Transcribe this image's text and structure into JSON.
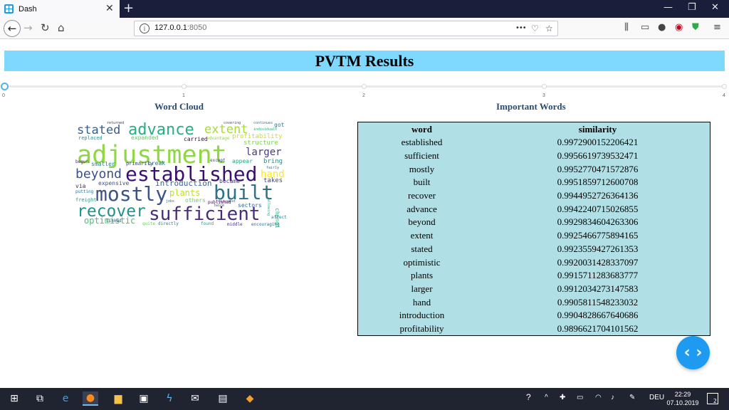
{
  "browser": {
    "tab_title": "Dash",
    "close_glyph": "✕",
    "newtab_glyph": "+",
    "url_host": "127.0.0.1",
    "url_port": ":8050",
    "more_glyph": "•••",
    "win_minimize": "—",
    "win_restore": "❐",
    "win_close": "✕"
  },
  "page": {
    "title": "PVTM Results",
    "word_cloud_title": "Word Cloud",
    "important_words_title": "Important Words"
  },
  "slider": {
    "marks": [
      "0",
      "1",
      "2",
      "3",
      "4"
    ],
    "value": 0
  },
  "word_cloud": {
    "words": [
      {
        "text": "adjustment",
        "color": "#8fd744"
      },
      {
        "text": "established",
        "color": "#3b0f70"
      },
      {
        "text": "sufficient",
        "color": "#472d7b"
      },
      {
        "text": "mostly",
        "color": "#3b528b"
      },
      {
        "text": "built",
        "color": "#2c728e"
      },
      {
        "text": "recover",
        "color": "#21918c"
      },
      {
        "text": "advance",
        "color": "#28ae80"
      },
      {
        "text": "beyond",
        "color": "#3b528b"
      },
      {
        "text": "extent",
        "color": "#a8db34"
      },
      {
        "text": "stated",
        "color": "#35608d"
      },
      {
        "text": "optimistic",
        "color": "#4ac16d"
      },
      {
        "text": "plants",
        "color": "#bddf26"
      },
      {
        "text": "larger",
        "color": "#443983"
      },
      {
        "text": "hand",
        "color": "#fde725"
      },
      {
        "text": "introduction",
        "color": "#31688e"
      },
      {
        "text": "profitability",
        "color": "#c2df23"
      },
      {
        "text": "structure",
        "color": "#7ad151"
      },
      {
        "text": "bring",
        "color": "#21918c"
      },
      {
        "text": "takes",
        "color": "#414487"
      },
      {
        "text": "carried",
        "color": "#440154"
      },
      {
        "text": "break",
        "color": "#2a788e"
      },
      {
        "text": "expanded",
        "color": "#5ec962"
      },
      {
        "text": "primarily",
        "color": "#3e4989"
      },
      {
        "text": "became",
        "color": "#46327e"
      },
      {
        "text": "sectors",
        "color": "#31688e"
      },
      {
        "text": "appear",
        "color": "#22a884"
      },
      {
        "text": "expensive",
        "color": "#3b528b"
      },
      {
        "text": "smaller",
        "color": "#26828e"
      },
      {
        "text": "others",
        "color": "#6ece58"
      },
      {
        "text": "via",
        "color": "#481f70"
      },
      {
        "text": "putting",
        "color": "#2d708e"
      },
      {
        "text": "freight",
        "color": "#1f9e89"
      },
      {
        "text": "published",
        "color": "#440154"
      },
      {
        "text": "changing",
        "color": "#35b779"
      },
      {
        "text": "got",
        "color": "#2a788e"
      },
      {
        "text": "advantage",
        "color": "#95d840"
      },
      {
        "text": "except",
        "color": "#3f4788"
      },
      {
        "text": "begun",
        "color": "#482576"
      },
      {
        "text": "jobs",
        "color": "#31688e"
      },
      {
        "text": "directly",
        "color": "#277f8e"
      },
      {
        "text": "twice",
        "color": "#39568c"
      },
      {
        "text": "found",
        "color": "#1fa187"
      },
      {
        "text": "middle",
        "color": "#453781"
      },
      {
        "text": "encouraging",
        "color": "#2e6f8e"
      },
      {
        "text": "affect",
        "color": "#24868e"
      },
      {
        "text": "linked",
        "color": "#3b528b"
      },
      {
        "text": "quite",
        "color": "#6ece58"
      },
      {
        "text": "replaced",
        "color": "#1f988b"
      },
      {
        "text": "returned",
        "color": "#482878"
      },
      {
        "text": "covering",
        "color": "#3e4a89"
      },
      {
        "text": "continues",
        "color": "#2a778e"
      },
      {
        "text": "individuals",
        "color": "#25ac82"
      },
      {
        "text": "projects",
        "color": "#3b528b"
      },
      {
        "text": "allowing",
        "color": "#29af7f"
      },
      {
        "text": "requirement",
        "color": "#482173"
      },
      {
        "text": "fairly",
        "color": "#2c728e"
      }
    ]
  },
  "table": {
    "columns": [
      "word",
      "similarity"
    ],
    "rows": [
      [
        "established",
        "0.9972900152206421"
      ],
      [
        "sufficient",
        "0.9956619739532471"
      ],
      [
        "mostly",
        "0.9952770471572876"
      ],
      [
        "built",
        "0.9951859712600708"
      ],
      [
        "recover",
        "0.9944952726364136"
      ],
      [
        "advance",
        "0.9942240715026855"
      ],
      [
        "beyond",
        "0.9929834604263306"
      ],
      [
        "extent",
        "0.9925466775894165"
      ],
      [
        "stated",
        "0.9923559427261353"
      ],
      [
        "optimistic",
        "0.9920031428337097"
      ],
      [
        "plants",
        "0.9915711283683777"
      ],
      [
        "larger",
        "0.9912034273147583"
      ],
      [
        "hand",
        "0.9905811548233032"
      ],
      [
        "introduction",
        "0.9904828667640686"
      ],
      [
        "profitability",
        "0.9896621704101562"
      ]
    ]
  },
  "fab": {
    "glyph": "‹ ›"
  },
  "taskbar": {
    "lang": "DEU",
    "time": "22:29",
    "date": "07.10.2019",
    "notification_count": "2"
  }
}
